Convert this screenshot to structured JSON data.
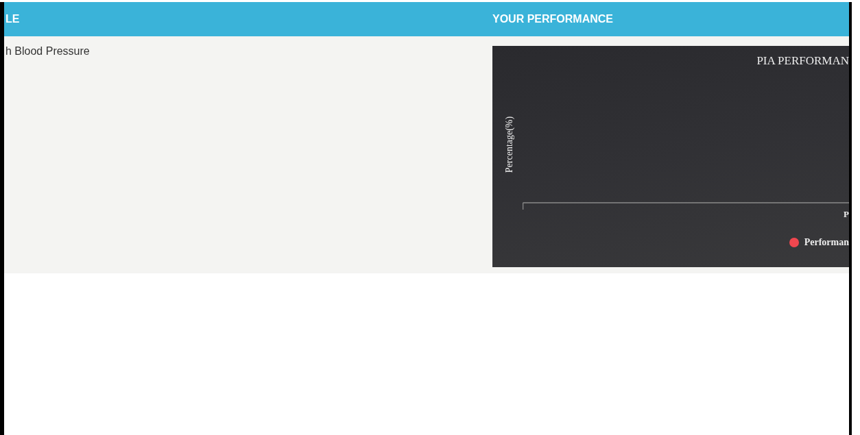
{
  "table": {
    "columns": [
      "LE",
      "YOUR PERFORMANCE"
    ],
    "rows": [
      {
        "cells": [
          "h Blood Pressure"
        ],
        "chart": {
          "title": "PIA PERFORMAN",
          "ylabel": "Percentage(%)",
          "category": "P",
          "legend": [
            {
              "label": "Performan",
              "color": "#f0474f"
            }
          ]
        }
      }
    ]
  }
}
